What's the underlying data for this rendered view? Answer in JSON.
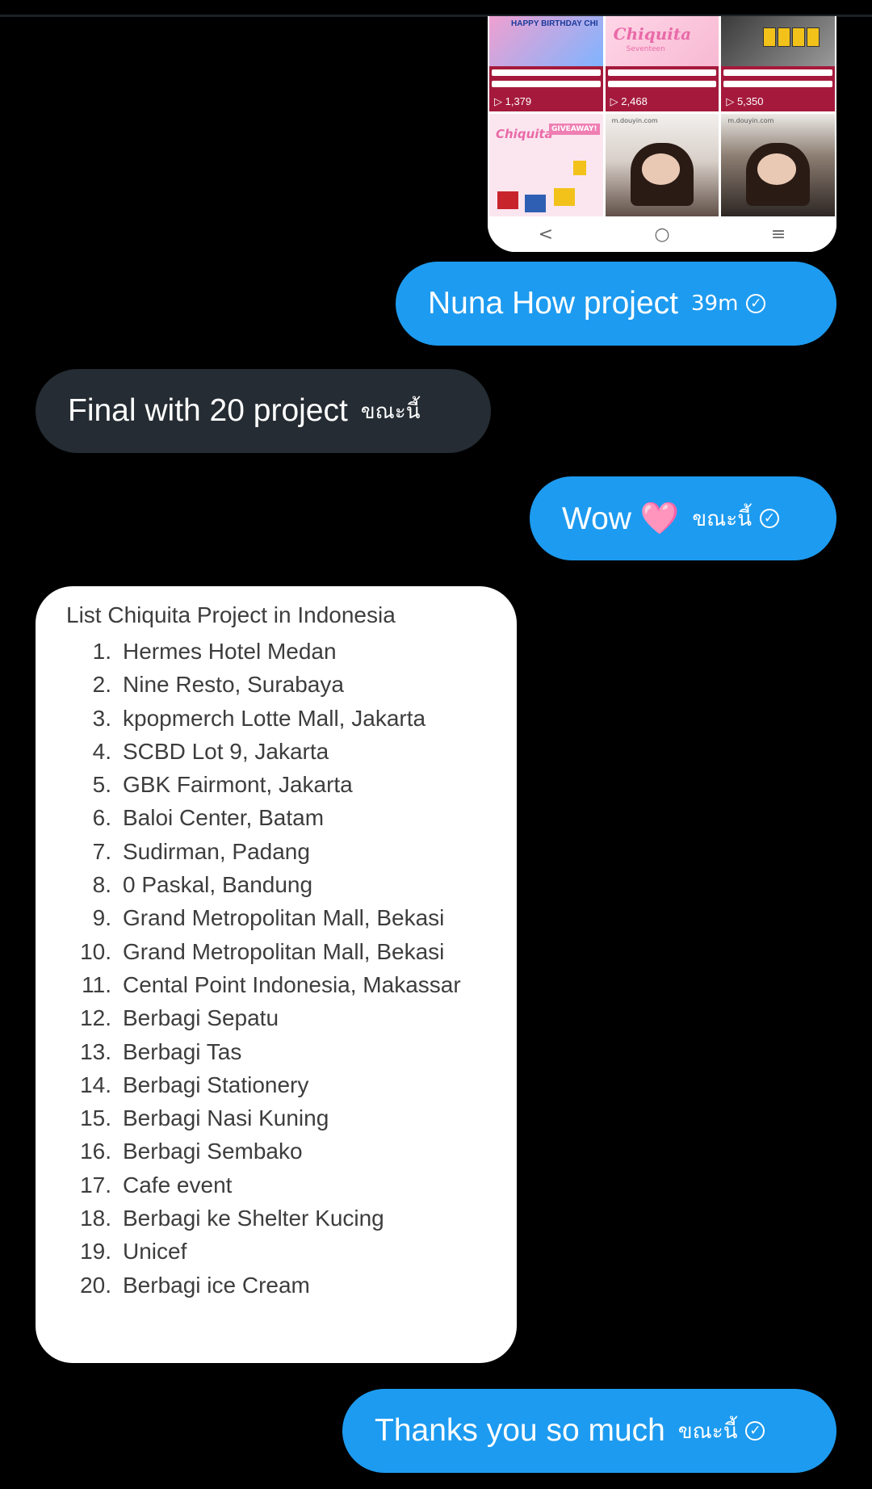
{
  "screenshot": {
    "tiles": [
      {
        "tag": "HAPPY BIRTHDAY CHI",
        "views": "▷ 1,379"
      },
      {
        "brand": "Chiquita",
        "sub": "Seventeen",
        "views": "▷ 2,468"
      },
      {
        "views": "▷ 5,350"
      }
    ],
    "giveaway": {
      "brand": "Chiquita",
      "tag": "GIVEAWAY!"
    },
    "photo_url": "m.douyin.com",
    "nav": {
      "back": "<",
      "home": "○",
      "menu": "≡"
    }
  },
  "messages": [
    {
      "direction": "out",
      "text": "Nuna How project",
      "time": "39m",
      "status": "read"
    },
    {
      "direction": "in",
      "text": "Final with 20 project",
      "time": "ขณะนี้"
    },
    {
      "direction": "out",
      "text": "Wow 🩷",
      "time": "ขณะนี้",
      "status": "read"
    },
    {
      "direction": "out",
      "text": "Thanks you so much",
      "time": "ขณะนี้",
      "status": "read"
    }
  ],
  "project_list": {
    "title": "List Chiquita Project in Indonesia",
    "items": [
      {
        "n": "1.",
        "text": "Hermes Hotel Medan"
      },
      {
        "n": "2.",
        "text": "Nine Resto, Surabaya"
      },
      {
        "n": "3.",
        "text": "kpopmerch Lotte Mall, Jakarta"
      },
      {
        "n": "4.",
        "text": "SCBD Lot 9, Jakarta"
      },
      {
        "n": "5.",
        "text": "GBK Fairmont, Jakarta"
      },
      {
        "n": "6.",
        "text": "Baloi Center, Batam"
      },
      {
        "n": "7.",
        "text": "Sudirman, Padang"
      },
      {
        "n": "8.",
        "text": "0 Paskal, Bandung"
      },
      {
        "n": "9.",
        "text": "Grand Metropolitan Mall, Bekasi"
      },
      {
        "n": "10.",
        "text": "Grand Metropolitan Mall, Bekasi"
      },
      {
        "n": "11.",
        "text": "Cental Point Indonesia, Makassar"
      },
      {
        "n": "12.",
        "text": "Berbagi Sepatu"
      },
      {
        "n": "13.",
        "text": "Berbagi Tas"
      },
      {
        "n": "14.",
        "text": "Berbagi Stationery"
      },
      {
        "n": "15.",
        "text": "Berbagi Nasi Kuning"
      },
      {
        "n": "16.",
        "text": "Berbagi Sembako"
      },
      {
        "n": "17.",
        "text": "Cafe event"
      },
      {
        "n": "18.",
        "text": "Berbagi ke Shelter Kucing"
      },
      {
        "n": "19.",
        "text": "Unicef"
      },
      {
        "n": "20.",
        "text": "Berbagi ice Cream"
      }
    ]
  },
  "colors": {
    "outgoing": "#1d9bf0",
    "incoming": "#252c33",
    "background": "#000000"
  }
}
